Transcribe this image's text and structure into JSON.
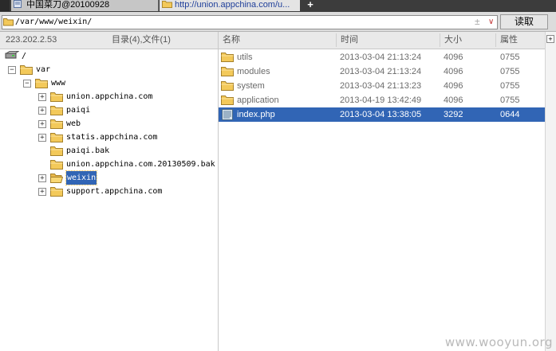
{
  "tabs": [
    {
      "label": "中国菜刀@20100928"
    },
    {
      "label": "http://union.appchina.com/u..."
    }
  ],
  "tab_add_label": "+",
  "address": {
    "path": "/var/www/weixin/",
    "plus": "±",
    "dropdown": "∨",
    "read_button": "读取"
  },
  "header": {
    "ip": "223.202.2.53",
    "summary": "目录(4),文件(1)",
    "col_name": "名称",
    "col_time": "时间",
    "col_size": "大小",
    "col_attr": "属性",
    "expand": "+"
  },
  "tree": [
    {
      "label": "/",
      "icon": "drive-icon",
      "toggle": ""
    },
    {
      "label": "var",
      "icon": "folder-icon",
      "toggle": "−"
    },
    {
      "label": "www",
      "icon": "folder-icon",
      "toggle": "−"
    },
    {
      "label": "union.appchina.com",
      "icon": "folder-icon",
      "toggle": "+"
    },
    {
      "label": "paiqi",
      "icon": "folder-icon",
      "toggle": "+"
    },
    {
      "label": "web",
      "icon": "folder-icon",
      "toggle": "+"
    },
    {
      "label": "statis.appchina.com",
      "icon": "folder-icon",
      "toggle": "+"
    },
    {
      "label": "paiqi.bak",
      "icon": "folder-icon",
      "toggle": ""
    },
    {
      "label": "union.appchina.com.20130509.bak",
      "icon": "folder-icon",
      "toggle": ""
    },
    {
      "label": "weixin",
      "icon": "folder-open-icon",
      "toggle": "+",
      "selected": true
    },
    {
      "label": "support.appchina.com",
      "icon": "folder-icon",
      "toggle": "+"
    }
  ],
  "files": [
    {
      "name": "utils",
      "time": "2013-03-04 21:13:24",
      "size": "4096",
      "attr": "0755",
      "type": "folder"
    },
    {
      "name": "modules",
      "time": "2013-03-04 21:13:24",
      "size": "4096",
      "attr": "0755",
      "type": "folder"
    },
    {
      "name": "system",
      "time": "2013-03-04 21:13:23",
      "size": "4096",
      "attr": "0755",
      "type": "folder"
    },
    {
      "name": "application",
      "time": "2013-04-19 13:42:49",
      "size": "4096",
      "attr": "0755",
      "type": "folder"
    },
    {
      "name": "index.php",
      "time": "2013-03-04 13:38:05",
      "size": "3292",
      "attr": "0644",
      "type": "file",
      "selected": true
    }
  ],
  "watermark": "www.wooyun.org",
  "colors": {
    "selection": "#3165b5",
    "folder": "#f3c95a",
    "tab_link": "#1f3f9a"
  }
}
